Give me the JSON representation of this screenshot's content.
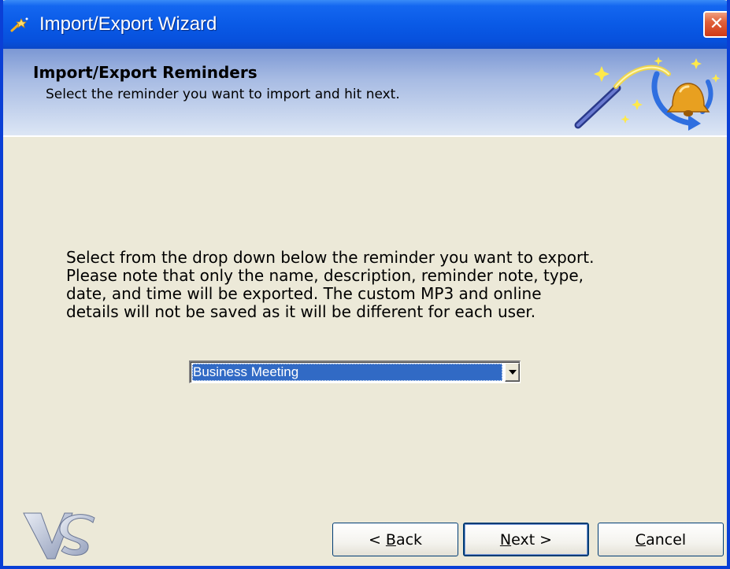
{
  "window": {
    "title": "Import/Export Wizard",
    "close_label": "✕"
  },
  "header": {
    "title": "Import/Export Reminders",
    "subtitle": "Select the reminder you want to import and hit next."
  },
  "body": {
    "lines": [
      "Select from the drop down below the reminder you want to export.",
      "Please note that only the name, description, reminder note, type,",
      "date, and time will be exported.  The custom MP3 and online",
      "details will not be saved as it will be different for each user."
    ]
  },
  "reminder_select": {
    "selected": "Business Meeting"
  },
  "buttons": {
    "back": {
      "prefix": "< ",
      "mnemonic": "B",
      "rest": "ack"
    },
    "next": {
      "mnemonic": "N",
      "rest": "ext >"
    },
    "cancel": {
      "mnemonic": "C",
      "rest": "ancel"
    }
  },
  "icons": {
    "app": "wizard-wand-icon",
    "header": "wizard-bell-graphic",
    "logo": "vs-logo",
    "dropdown": "chevron-down-icon"
  },
  "colors": {
    "titlebar": "#0a5ae6",
    "dialog_bg": "#ece9d8",
    "selection": "#316ac5",
    "close": "#cf3a18"
  }
}
